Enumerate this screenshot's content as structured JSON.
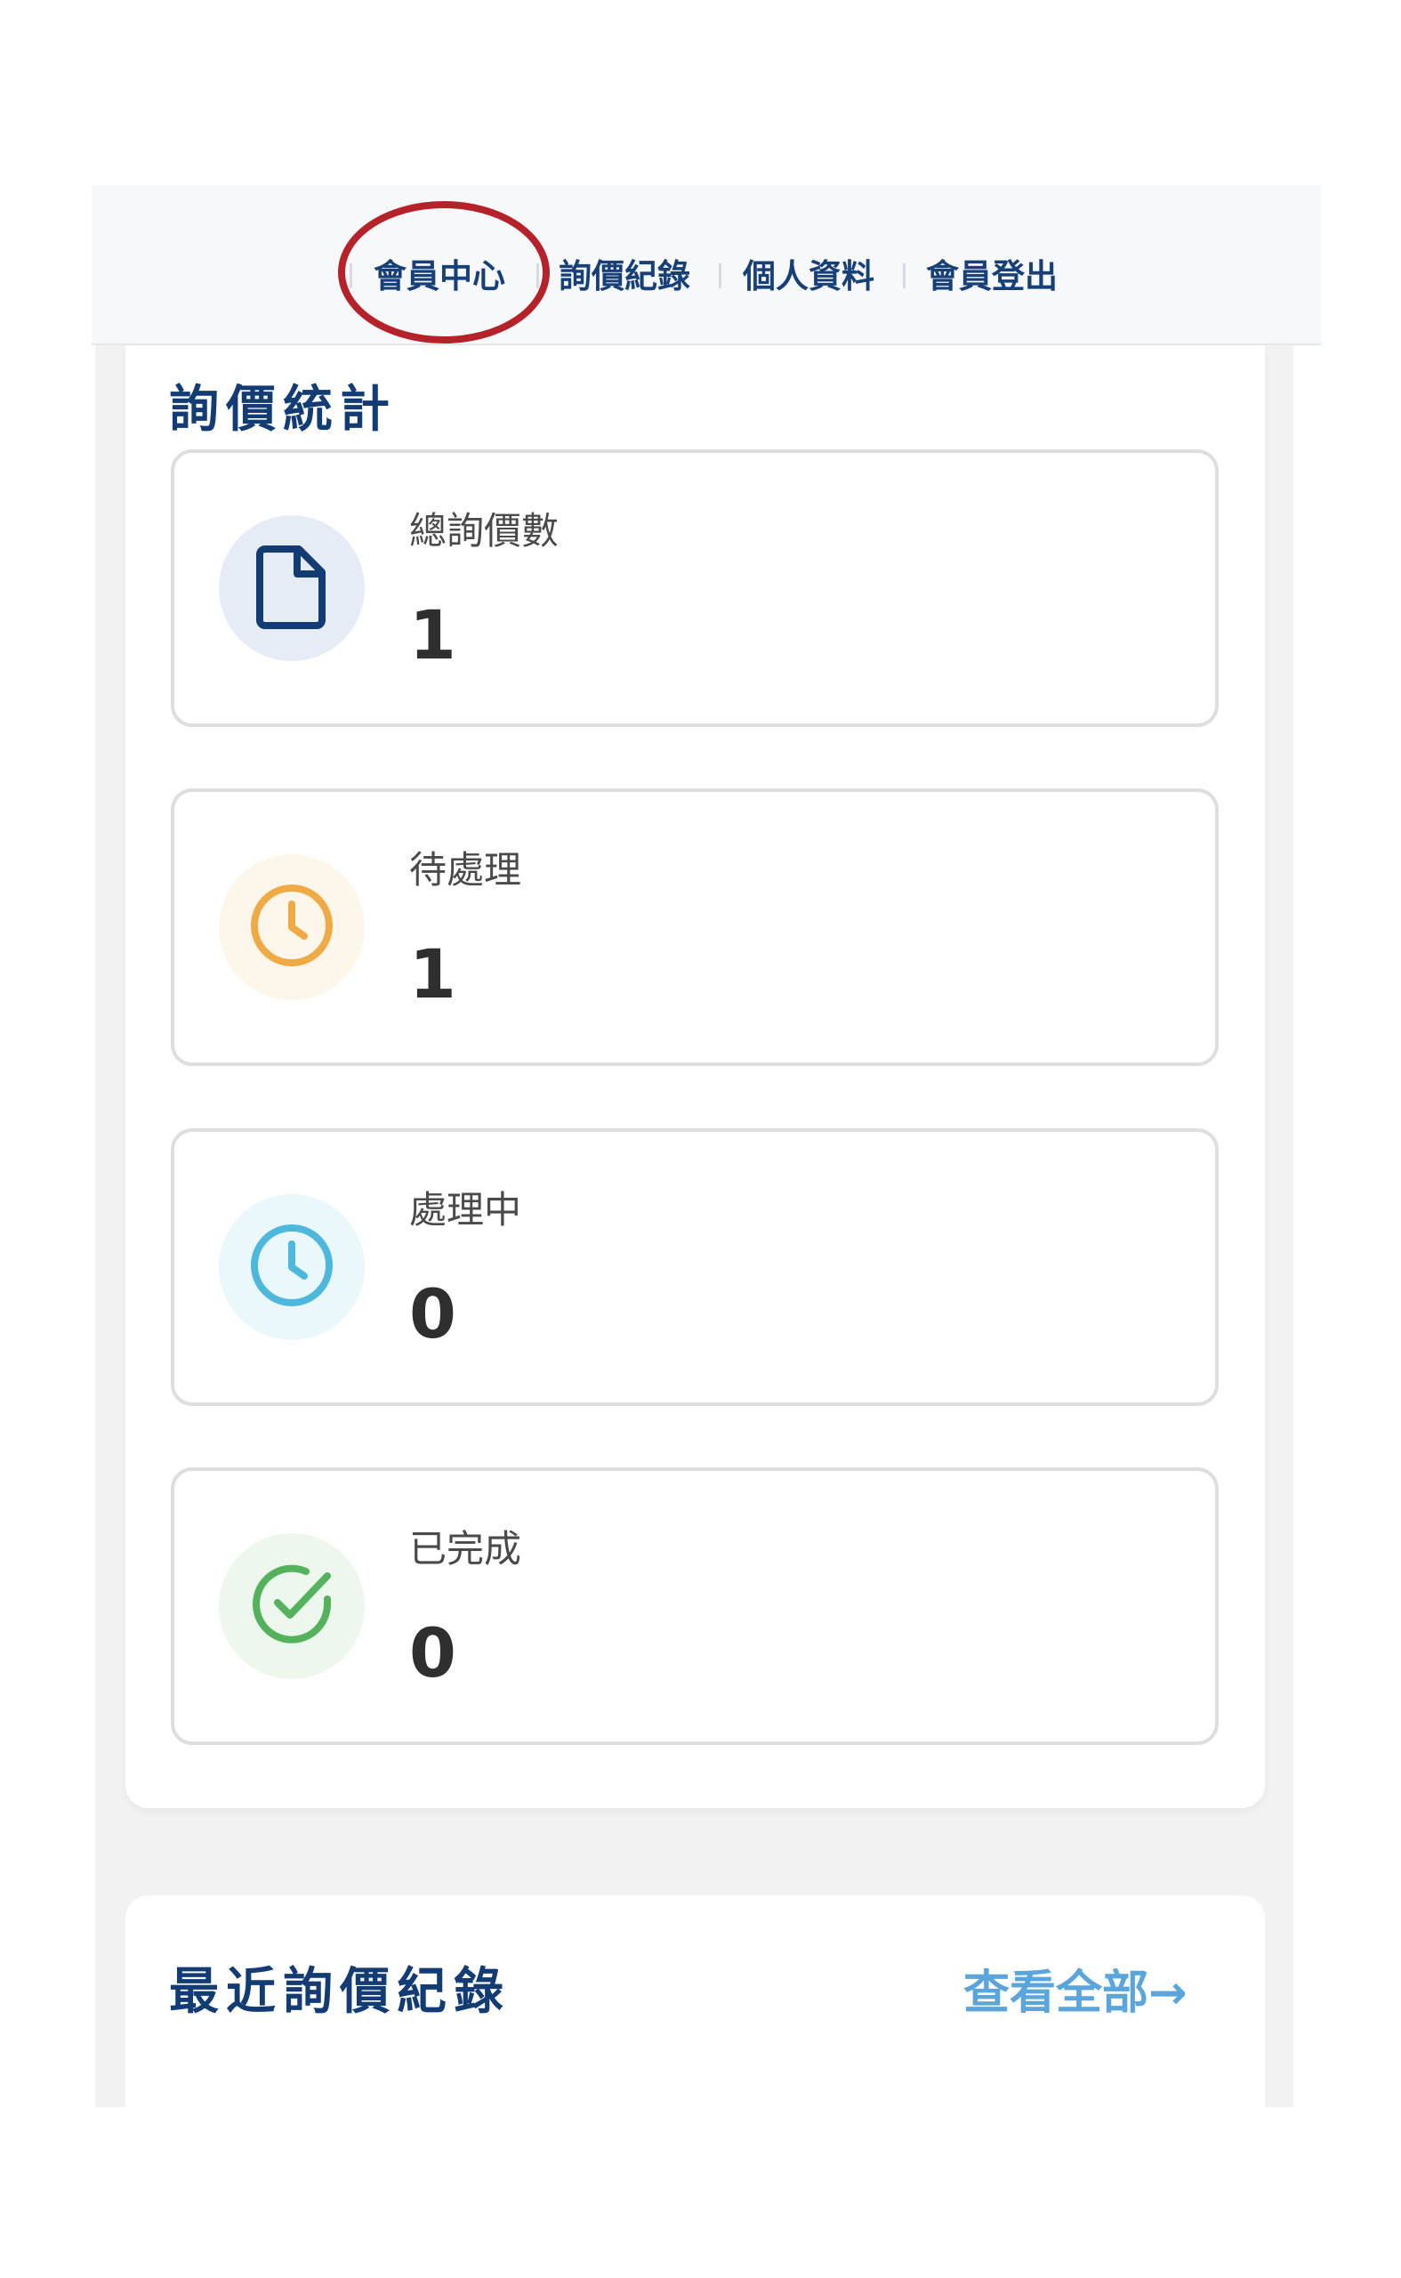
{
  "nav": {
    "items": [
      {
        "label": "會員中心"
      },
      {
        "label": "詢價紀錄"
      },
      {
        "label": "個人資料"
      },
      {
        "label": "會員登出"
      }
    ]
  },
  "stats": {
    "title": "詢價統計",
    "cards": [
      {
        "label": "總詢價數",
        "value": "1",
        "icon": "document-icon",
        "icon_color": "#123c73",
        "icon_bg": "#e6ecf5"
      },
      {
        "label": "待處理",
        "value": "1",
        "icon": "clock-icon",
        "icon_color": "#f0aa45",
        "icon_bg": "#fdf6ea"
      },
      {
        "label": "處理中",
        "value": "0",
        "icon": "clock-icon",
        "icon_color": "#4db7dc",
        "icon_bg": "#eaf7fb"
      },
      {
        "label": "已完成",
        "value": "0",
        "icon": "check-circle-icon",
        "icon_color": "#55b25c",
        "icon_bg": "#edf7ee"
      }
    ]
  },
  "recent": {
    "title": "最近詢價紀錄",
    "view_all_label": "查看全部→"
  },
  "colors": {
    "primary": "#123c73",
    "link": "#5aa6dc",
    "highlight": "#b5222a"
  }
}
